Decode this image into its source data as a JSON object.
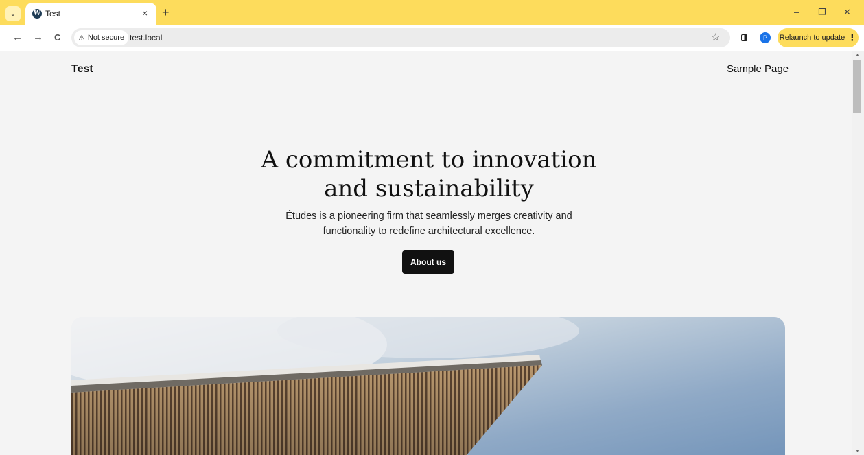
{
  "browser": {
    "tab_title": "Test",
    "tab_close": "×",
    "new_tab": "+",
    "tab_search_icon": "⌄",
    "minimize": "–",
    "restore": "❐",
    "close": "✕",
    "back": "←",
    "forward": "→",
    "reload": "C",
    "security_label": "Not secure",
    "url": "test.local",
    "profile_initial": "P",
    "relaunch_label": "Relaunch to update",
    "relaunch_dots": "⋮",
    "accent_color": "#fddc5c"
  },
  "site": {
    "title": "Test",
    "nav": [
      "Sample Page"
    ]
  },
  "hero": {
    "heading_line1": "A commitment to innovation",
    "heading_line2": "and sustainability",
    "text_line1": "Études is a pioneering firm that seamlessly merges creativity and",
    "text_line2": "functionality to redefine architectural excellence.",
    "button_label": "About us"
  }
}
